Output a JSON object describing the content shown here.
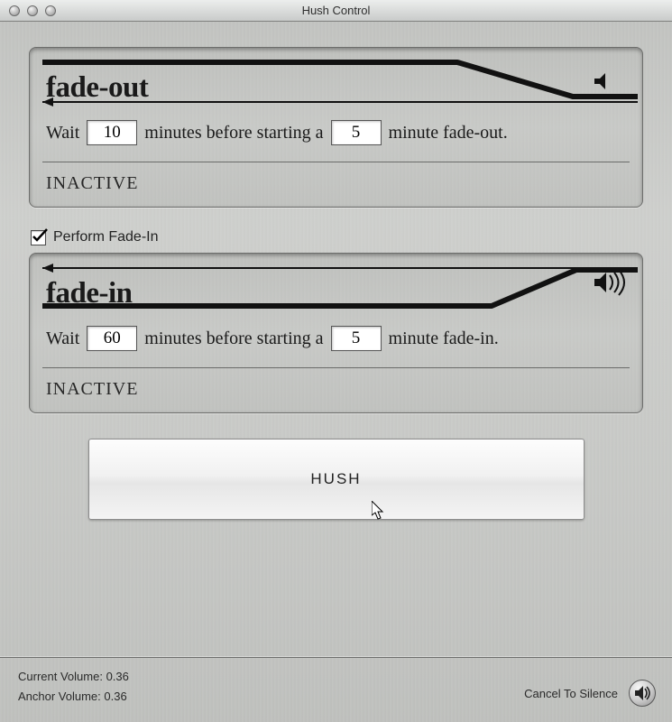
{
  "window": {
    "title": "Hush Control"
  },
  "fade_out": {
    "title": "fade-out",
    "wait_label": "Wait",
    "wait_minutes": "10",
    "mid1": "minutes before starting a",
    "duration_minutes": "5",
    "mid2": "minute fade-out.",
    "status": "INACTIVE"
  },
  "perform_fade_in": {
    "checked": true,
    "label": "Perform Fade-In"
  },
  "fade_in": {
    "title": "fade-in",
    "wait_label": "Wait",
    "wait_minutes": "60",
    "mid1": "minutes before starting a",
    "duration_minutes": "5",
    "mid2": "minute fade-in.",
    "status": "INACTIVE"
  },
  "hush_button": "HUSH",
  "footer": {
    "current_label": "Current Volume:",
    "current_value": "0.36",
    "anchor_label": "Anchor Volume:",
    "anchor_value": "0.36",
    "cancel_label": "Cancel To Silence"
  }
}
